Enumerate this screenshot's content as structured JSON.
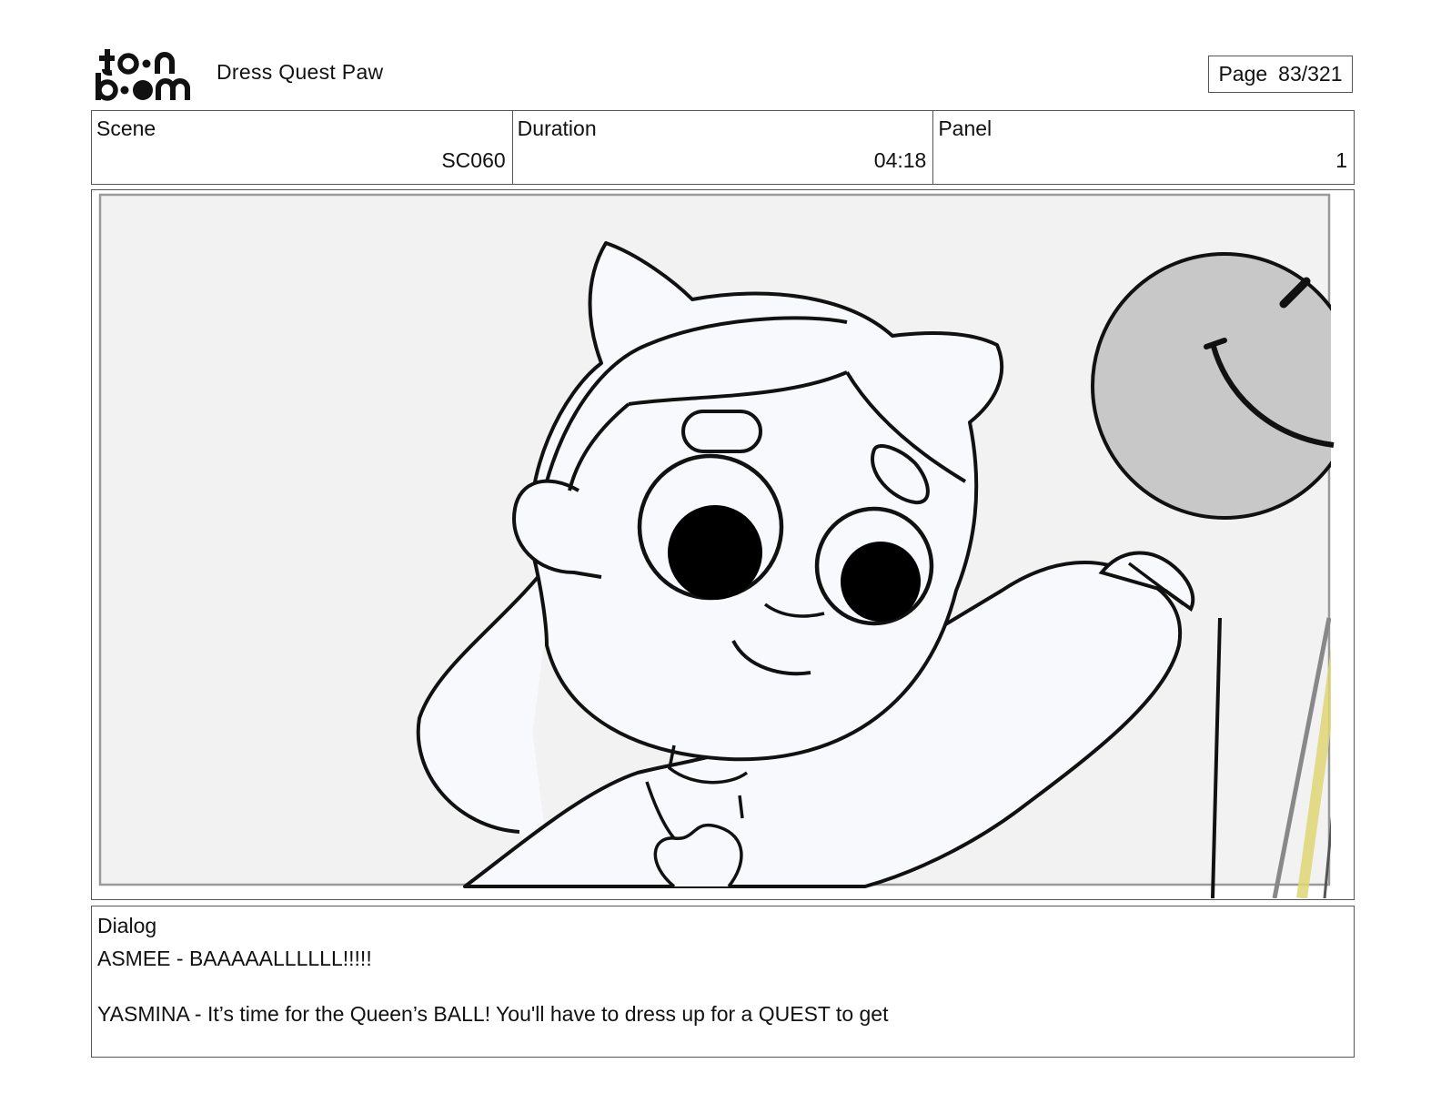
{
  "header": {
    "logo_text": "toonboom",
    "project_title": "Dress Quest Paw",
    "page_label": "Page",
    "page_value": "83/321"
  },
  "info": {
    "scene_label": "Scene",
    "scene_value": "SC060",
    "duration_label": "Duration",
    "duration_value": "04:18",
    "panel_label": "Panel",
    "panel_value": "1"
  },
  "panel": {
    "image_icon": "storyboard-sketch-girl-with-smiley-balloon",
    "background_color": "#f2f2f2",
    "balloon_color": "#c8c8c8",
    "accent_color": "#e0d676"
  },
  "dialog": {
    "label": "Dialog",
    "lines": [
      "ASMEE - BAAAAALLLLLL!!!!!",
      "YASMINA - It’s time for the Queen’s BALL! You'll have to dress up for a QUEST to get"
    ]
  }
}
